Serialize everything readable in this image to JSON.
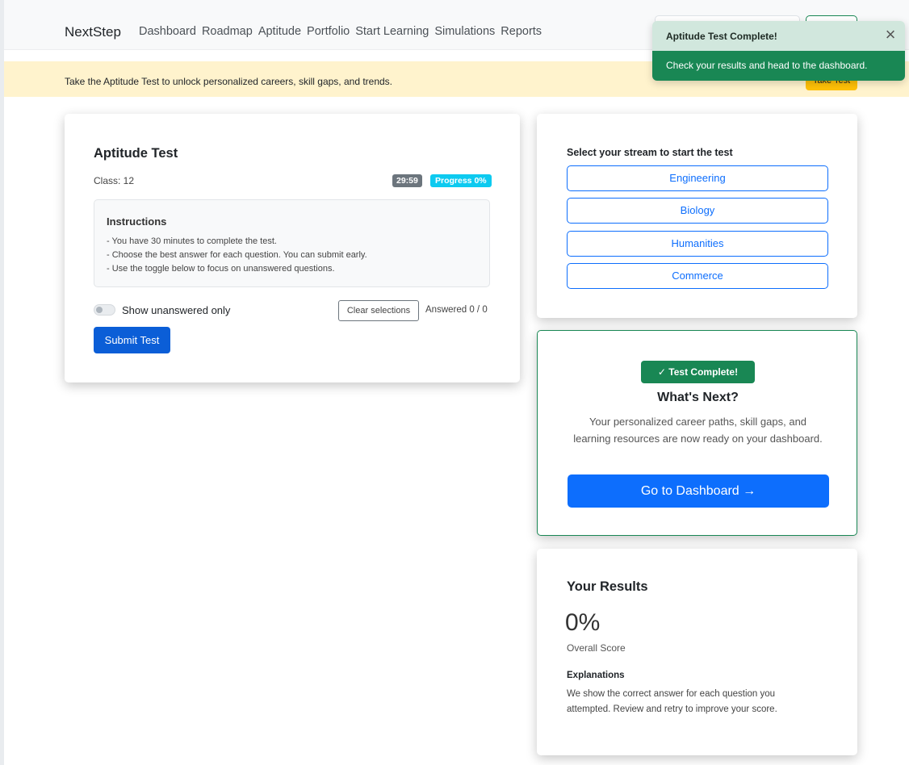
{
  "navbar": {
    "brand": "NextStep",
    "links": [
      "Dashboard",
      "Roadmap",
      "Aptitude",
      "Portfolio",
      "Start Learning",
      "Simulations",
      "Reports"
    ]
  },
  "banner": {
    "text": "Take the Aptitude Test to unlock personalized careers, skill gaps, and trends.",
    "button_label": "Take Test"
  },
  "toast": {
    "title": "Aptitude Test Complete!",
    "message": "Check your results and head to the dashboard.",
    "close_glyph": "×"
  },
  "test": {
    "title": "Aptitude Test",
    "class_label": "Class: 12",
    "timer": "29:59",
    "progress": "Progress 0%",
    "instructions_title": "Instructions",
    "instructions": [
      "- You have 30 minutes to complete the test.",
      "- Choose the best answer for each question. You can submit early.",
      "- Use the toggle below to focus on unanswered questions."
    ],
    "toggle_label": "Show unanswered only",
    "clear_label": "Clear selections",
    "answered": "Answered 0 / 0",
    "submit_label": "Submit Test"
  },
  "streams": {
    "title": "Select your stream to start the test",
    "options": [
      "Engineering",
      "Biology",
      "Humanities",
      "Commerce"
    ]
  },
  "next": {
    "badge": "✓ Test Complete!",
    "title": "What's Next?",
    "description": "Your personalized career paths, skill gaps, and learning resources are now ready on your dashboard.",
    "button_label": "Go to Dashboard →"
  },
  "results": {
    "title": "Your Results",
    "score": "0%",
    "score_label": "Overall Score",
    "explanations_title": "Explanations",
    "explanations_text": "We show the correct answer for each question you attempted. Review and retry to improve your score."
  },
  "colors": {
    "primary": "#0d6efd",
    "success": "#198754",
    "warning_bg": "#fff3cd",
    "info": "#0dcaf0"
  }
}
